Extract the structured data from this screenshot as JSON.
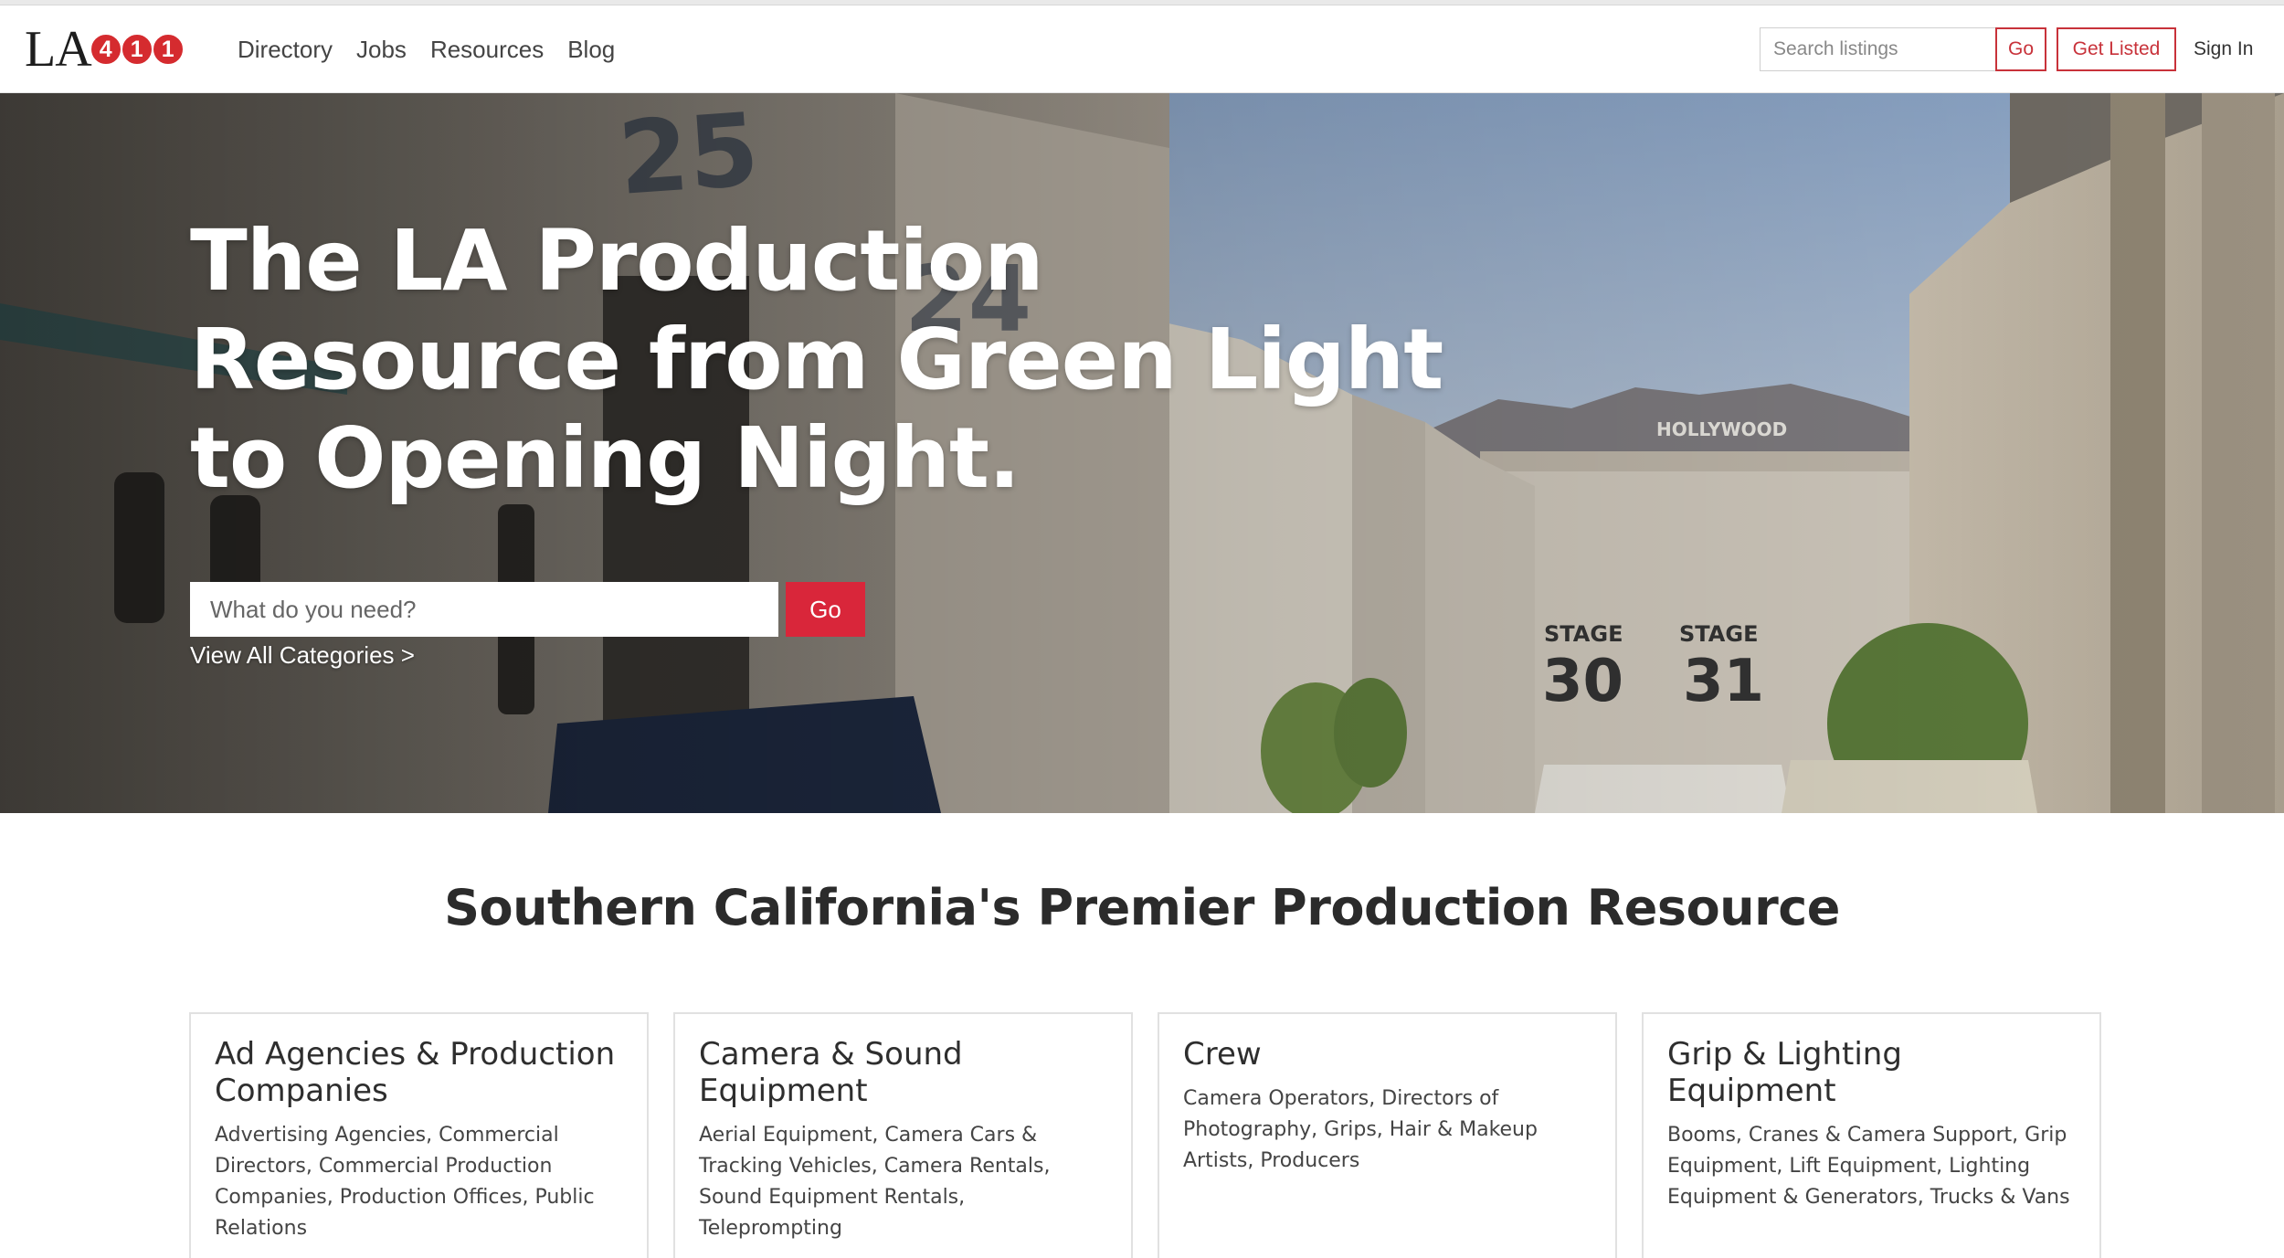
{
  "logo": {
    "prefix": "LA",
    "digits": [
      "4",
      "1",
      "1"
    ]
  },
  "nav": {
    "links": [
      "Directory",
      "Jobs",
      "Resources",
      "Blog"
    ]
  },
  "header_search": {
    "placeholder": "Search listings",
    "button": "Go"
  },
  "header_actions": {
    "get_listed": "Get Listed",
    "sign_in": "Sign In"
  },
  "hero": {
    "title": "The LA Production Resource from Green Light to Opening Night.",
    "search_placeholder": "What do you need?",
    "search_button": "Go",
    "view_all": "View All Categories >",
    "sign_text": [
      "STAGE",
      "30",
      "STAGE",
      "31",
      "HOLLYWOOD",
      "25",
      "STAGE",
      "24"
    ]
  },
  "section": {
    "title": "Southern California's Premier Production Resource"
  },
  "cards": [
    {
      "title": "Ad Agencies & Production Companies",
      "desc": "Advertising Agencies, Commercial Directors, Commercial Production Companies, Production Offices, Public Relations"
    },
    {
      "title": "Camera & Sound Equipment",
      "desc": "Aerial Equipment, Camera Cars & Tracking Vehicles, Camera Rentals, Sound Equipment Rentals, Teleprompting"
    },
    {
      "title": "Crew",
      "desc": "Camera Operators, Directors of Photography, Grips, Hair & Makeup Artists, Producers"
    },
    {
      "title": "Grip & Lighting Equipment",
      "desc": "Booms, Cranes & Camera Support, Grip Equipment, Lift Equipment, Lighting Equipment & Generators, Trucks & Vans"
    }
  ],
  "colors": {
    "brand_red": "#d9263a",
    "outline_red": "#c8323a"
  }
}
